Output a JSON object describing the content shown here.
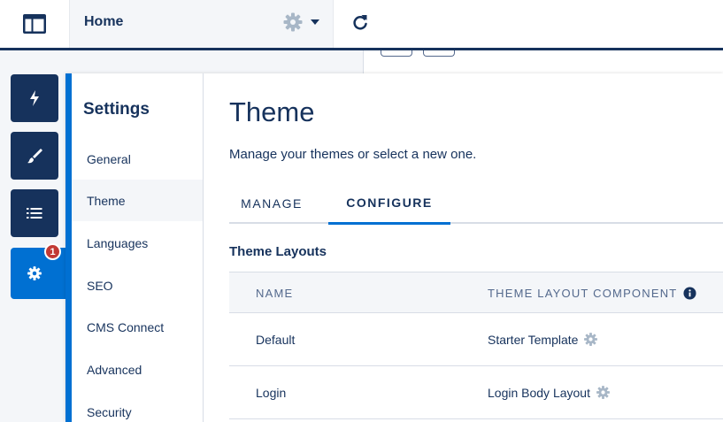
{
  "topbar": {
    "page_name": "Home",
    "icons": {
      "app_switcher": "layout-icon",
      "page_settings": "gear-icon",
      "page_menu": "caret-down-icon",
      "refresh": "refresh-icon"
    }
  },
  "rail": {
    "items": [
      {
        "name": "components",
        "icon": "lightning-icon"
      },
      {
        "name": "theme",
        "icon": "brush-icon"
      },
      {
        "name": "page-structure",
        "icon": "list-icon"
      },
      {
        "name": "settings",
        "icon": "gear-icon",
        "active": true,
        "badge": "1"
      }
    ]
  },
  "settings": {
    "heading": "Settings",
    "items": [
      {
        "label": "General"
      },
      {
        "label": "Theme",
        "selected": true
      },
      {
        "label": "Languages"
      },
      {
        "label": "SEO"
      },
      {
        "label": "CMS Connect"
      },
      {
        "label": "Advanced"
      },
      {
        "label": "Security"
      }
    ]
  },
  "theme": {
    "title": "Theme",
    "description": "Manage your themes or select a new one.",
    "tabs": [
      {
        "label": "MANAGE"
      },
      {
        "label": "CONFIGURE",
        "active": true
      }
    ],
    "section_title": "Theme Layouts",
    "table": {
      "headers": [
        "NAME",
        "THEME LAYOUT COMPONENT"
      ],
      "rows": [
        {
          "name": "Default",
          "component": "Starter Template"
        },
        {
          "name": "Login",
          "component": "Login Body Layout"
        }
      ]
    }
  },
  "colors": {
    "navy": "#16325c",
    "brand_blue": "#0070d2",
    "badge_red": "#c23934",
    "muted": "#54698d",
    "gear_gray": "#a8b7c7"
  }
}
